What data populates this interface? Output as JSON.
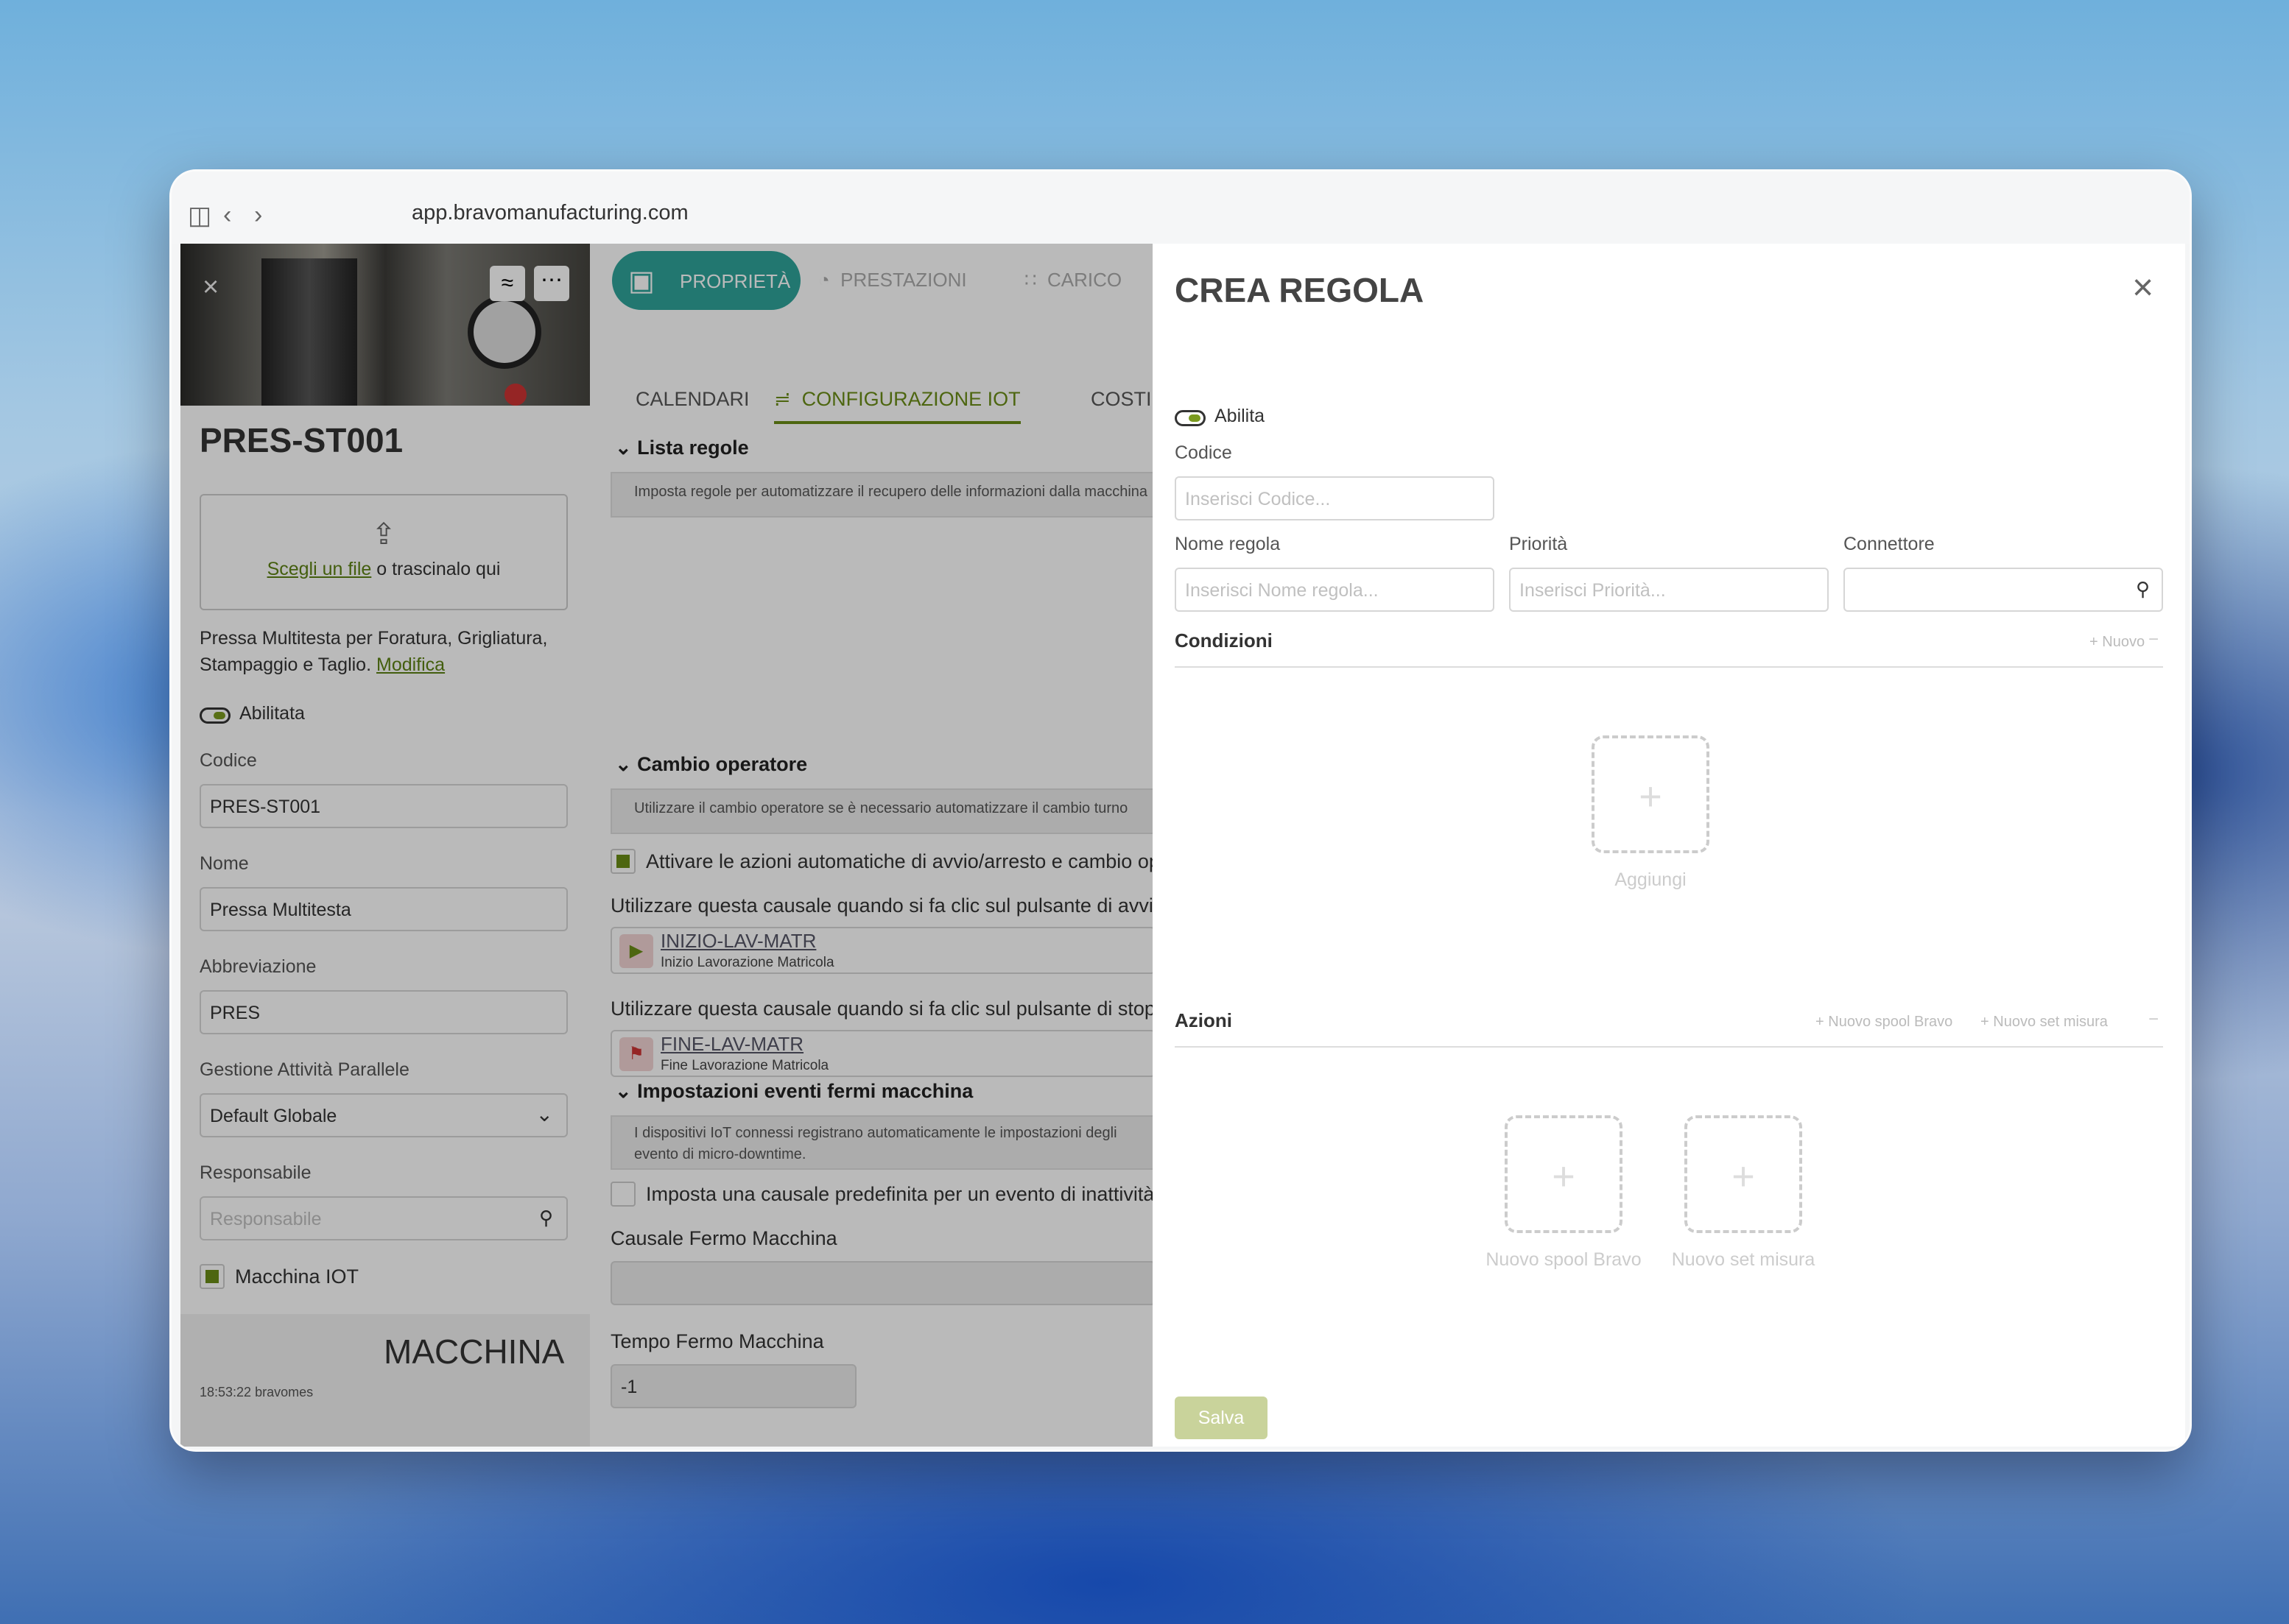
{
  "browser": {
    "url": "app.bravomanufacturing.com"
  },
  "left": {
    "title": "PRES-ST001",
    "upload_link": "Scegli un file",
    "upload_rest": " o trascinalo qui",
    "description": "Pressa Multitesta per Foratura, Grigliatura, Stampaggio e Taglio.",
    "modify": "Modifica",
    "enabled_label": "Abilitata",
    "code_label": "Codice",
    "code_value": "PRES-ST001",
    "name_label": "Nome",
    "name_value": "Pressa Multitesta",
    "abbr_label": "Abbreviazione",
    "abbr_value": "PRES",
    "parallel_label": "Gestione Attività Parallele",
    "parallel_value": "Default Globale",
    "resp_label": "Responsabile",
    "resp_placeholder": "Responsabile",
    "iot_label": "Macchina IOT",
    "footer_title": "MACCHINA",
    "footer_time": "18:53:22 bravomes"
  },
  "tabs": {
    "top": [
      "PROPRIETÀ",
      "PRESTAZIONI",
      "CARICO"
    ],
    "sub": [
      "CALENDARI",
      "CONFIGURAZIONE IOT",
      "COSTI"
    ]
  },
  "mid": {
    "rules_title": "Lista regole",
    "rules_desc": "Imposta regole per automatizzare il recupero delle informazioni dalla macchina",
    "op_title": "Cambio operatore",
    "op_desc": "Utilizzare il cambio operatore se è necessario automatizzare il cambio turno",
    "op_check": "Attivare le azioni automatiche di avvio/arresto e cambio operatore",
    "start_text": "Utilizzare questa causale quando si fa clic sul pulsante di avvio",
    "start_code": "INIZIO-LAV-MATR",
    "start_sub": "Inizio Lavorazione Matricola",
    "stop_text": "Utilizzare questa causale quando si fa clic sul pulsante di stop",
    "stop_code": "FINE-LAV-MATR",
    "stop_sub": "Fine Lavorazione Matricola",
    "events_title": "Impostazioni eventi fermi macchina",
    "events_desc1": "I dispositivi IoT connessi registrano automaticamente le impostazioni degli",
    "events_desc2": "evento di micro-downtime.",
    "idle_check": "Imposta una causale predefinita per un evento di inattività",
    "causale_label": "Causale Fermo Macchina",
    "tempo_label": "Tempo Fermo Macchina",
    "tempo_value": "-1"
  },
  "dialog": {
    "title": "CREA REGOLA",
    "enable_label": "Abilita",
    "code_label": "Codice",
    "code_placeholder": "Inserisci Codice...",
    "name_label": "Nome regola",
    "name_placeholder": "Inserisci Nome regola...",
    "priority_label": "Priorità",
    "priority_placeholder": "Inserisci Priorità...",
    "connector_label": "Connettore",
    "conditions_title": "Condizioni",
    "conditions_new": "Nuovo",
    "add_label": "Aggiungi",
    "actions_title": "Azioni",
    "action_spool": "Nuovo spool Bravo",
    "action_set": "Nuovo set misura",
    "save": "Salva"
  },
  "colors": {
    "accent": "#6a8d16",
    "tab_active": "#2fa49a"
  }
}
